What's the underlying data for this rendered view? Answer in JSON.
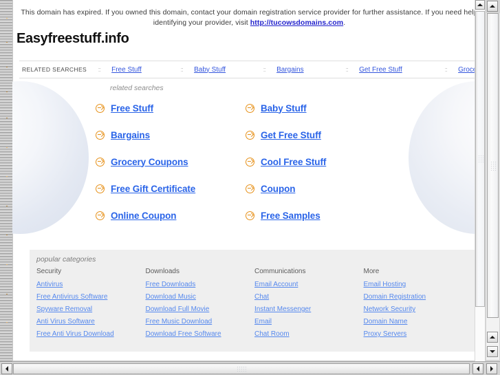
{
  "banner": {
    "text_before": "This domain has expired. If you owned this domain, contact your domain registration service provider for further assistance. If you need help identifying your provider, visit ",
    "link_text": "http://tucowsdomains.com",
    "text_after": "."
  },
  "site": {
    "title": "Easyfreestuff.info"
  },
  "topnav": {
    "label": "RELATED SEARCHES",
    "separator": "::",
    "links": [
      "Free Stuff",
      "Baby Stuff",
      "Bargains",
      "Get Free Stuff",
      "Grocery Coupons"
    ]
  },
  "related": {
    "caption": "related searches",
    "icon": "arrow-circle-right-icon",
    "left_column": [
      "Free Stuff",
      "Bargains",
      "Grocery Coupons",
      "Free Gift Certificate",
      "Online Coupon"
    ],
    "right_column": [
      "Baby Stuff",
      "Get Free Stuff",
      "Cool Free Stuff",
      "Coupon",
      "Free Samples"
    ]
  },
  "categories": {
    "caption": "popular categories",
    "columns": [
      {
        "heading": "Security",
        "links": [
          "Antivirus",
          "Free Antivirus Software",
          "Spyware Removal",
          "Anti Virus Software",
          "Free Anti Virus Download"
        ]
      },
      {
        "heading": "Downloads",
        "links": [
          "Free Downloads",
          "Download Music",
          "Download Full Movie",
          "Free Music Download",
          "Download Free Software"
        ]
      },
      {
        "heading": "Communications",
        "links": [
          "Email Account",
          "Chat",
          "Instant Messenger",
          "Email",
          "Chat Room"
        ]
      },
      {
        "heading": "More",
        "links": [
          "Email Hosting",
          "Domain Registration",
          "Network Security",
          "Domain Name",
          "Proxy Servers"
        ]
      }
    ]
  },
  "scrollbars": {
    "page_vertical": {
      "up_icon": "triangle-up-icon",
      "down_icon": "triangle-down-icon"
    },
    "window_vertical": {
      "up_icon": "triangle-up-icon",
      "down_icon": "triangle-down-icon"
    },
    "horizontal": {
      "left_icon": "triangle-left-icon",
      "right_icon": "triangle-right-icon"
    }
  },
  "colors": {
    "link_blue": "#2a64e8",
    "nav_link_blue": "#3355dd",
    "category_link_blue": "#5588ee",
    "bullet_orange": "#e8921a",
    "panel_gray": "#efefef",
    "banner_link": "#2222cc"
  }
}
